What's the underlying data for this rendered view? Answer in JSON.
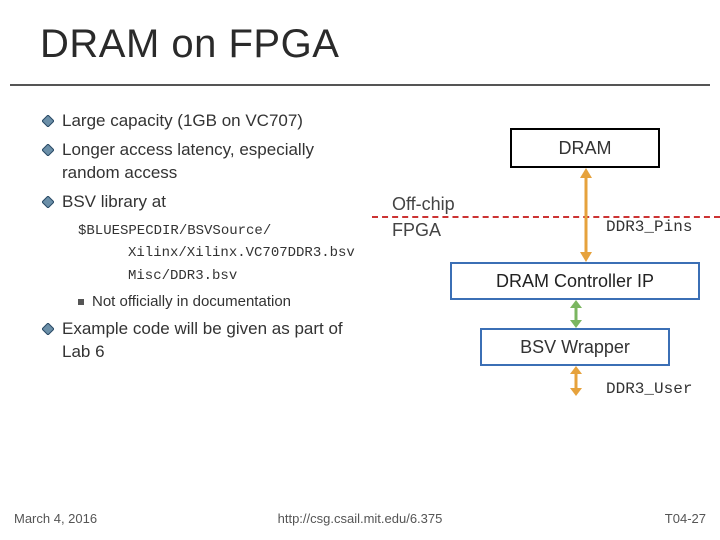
{
  "title": "DRAM on FPGA",
  "bullets": {
    "b1": "Large capacity (1GB on VC707)",
    "b2": "Longer access latency, especially random access",
    "b3": "BSV library at",
    "code1": "$BLUESPECDIR/BSVSource/",
    "code2": "Xilinx/Xilinx.VC707DDR3.bsv",
    "code3": "Misc/DDR3.bsv",
    "sub1": "Not officially in documentation",
    "b4": "Example code will be given as part of Lab 6"
  },
  "diagram": {
    "dram": "DRAM",
    "offchip": "Off-chip",
    "fpga": "FPGA",
    "ddr3pins": "DDR3_Pins",
    "controller": "DRAM Controller IP",
    "wrapper": "BSV Wrapper",
    "ddr3user": "DDR3_User"
  },
  "footer": {
    "date": "March 4, 2016",
    "url": "http://csg.csail.mit.edu/6.375",
    "page": "T04-27"
  }
}
